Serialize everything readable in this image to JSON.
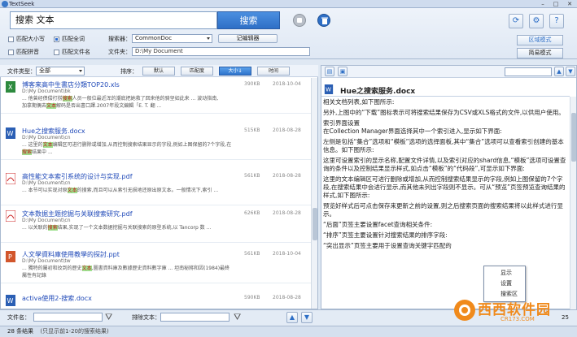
{
  "app": {
    "title": "TextSeek"
  },
  "search": {
    "query": "搜索 文本",
    "button": "搜索"
  },
  "options": {
    "match_case": "匹配大小写",
    "match_whole": "匹配全词",
    "match_pinyin": "匹配拼音",
    "match_filename": "匹配文件名",
    "index_label": "搜索器：",
    "index_value": "CommonDoc",
    "edit_button": "记编辑器",
    "files_label": "文件夹：",
    "files_value": "D:\\My Document"
  },
  "modes": {
    "zone": "区域模式",
    "simple": "简易模式"
  },
  "filter": {
    "type_label": "文件类型：",
    "type_value": "全部",
    "sort_label": "排序：",
    "sort_buttons": [
      "默认",
      "匹配度",
      "大小↓",
      "时间"
    ]
  },
  "results": [
    {
      "name": "博客来高中生書店分類TOP20.xls",
      "path": "D:\\My Document\\bk",
      "size": "390KB",
      "date": "2018-10-04",
      "snip1_a": "... 他曾经债偿打捞",
      "snip1_b": "搜索",
      "snip1_c": "人员一般位最近浑的潮底把她救了回来他的骑坚如此来 ... 波动指南,",
      "snip2_a": "加拿期偶去",
      "snip2_b": "文本",
      "snip2_c": "解码是否出書口譯.2007年段文編輯「E. T. 翻 ..."
    },
    {
      "name": "Hue之搜索服务.docx",
      "path": "D:\\My Document\\cn",
      "size": "515KB",
      "date": "2018-08-28",
      "snip1_a": "... 这里的",
      "snip1_b": "文本",
      "snip1_c": "编辑区可进行删除或增加,从而控制搜索结果显示的字段,例如上图保留的7个字段,在",
      "snip2_a": "搜索",
      "snip2_b": "结果中",
      "snip2_c": " ..."
    },
    {
      "name": "高性能文本索引系统的设计与实现.pdf",
      "path": "D:\\My Document\\cn",
      "size": "561KB",
      "date": "2018-08-28",
      "snip1_a": "... 本节可以实现对原",
      "snip1_b": "文本",
      "snip1_c": "的搜索,而且可以从索引无损地还原出原文本。一般情况下,索引 ...",
      "snip2_a": "",
      "snip2_b": "",
      "snip2_c": ""
    },
    {
      "name": "文本数据主题挖掘与关联搜索研究.pdf",
      "path": "D:\\My Document\\cn",
      "size": "626KB",
      "date": "2018-08-28",
      "snip1_a": "... 以关联的",
      "snip1_b": "搜索",
      "snip1_c": "结果,实现了一个文本数据挖掘与关联搜索的原型系统,以 Tancorp 数 ...",
      "snip2_a": "",
      "snip2_b": "",
      "snip2_c": ""
    },
    {
      "name": "人文學資料庫使用教學的探討.ppt",
      "path": "D:\\My Document\\tw",
      "size": "561KB",
      "date": "2018-10-04",
      "snip1_a": "... 獨特的屬初和玟到的歷史",
      "snip1_b": "文本",
      "snip1_c": ",圖書資料庫及數據歷史資料數字庫 ... 坦南秘將和因(1984)最終",
      "snip2_a": "屬性有記錄",
      "snip2_b": "",
      "snip2_c": " ..."
    },
    {
      "name": "activa使用2-搜索.docx",
      "path": "",
      "size": "590KB",
      "date": "2018-08-28",
      "snip1_a": "",
      "snip1_b": "",
      "snip1_c": "",
      "snip2_a": "",
      "snip2_b": "",
      "snip2_c": ""
    }
  ],
  "preview": {
    "title": "Hue之搜索服务.docx",
    "p1": "相关文档列表,如下图所示:",
    "p2": "另外,上图中的“下载”图标表示可将搜索结果保存为CSV或XLS格式的文件,以供用户使用。",
    "p3": "索引界面设置",
    "p4": "在Collection Manager界面选择其中一个索引进入,显示如下界面:",
    "p5": "左侧是包括“集合”选项和“模板”选项的选择面板,其中“集合”选项可以查看索引创建的基本信息。如下图所示:",
    "p6": "这里可设置索引的显示名称,配置文件详情,以及索引对应的shard信息,“模板”选项可设置查询的条件以及控制结果显示样式,如点击“模板”的“代码段”,可显示如下界面:",
    "p7": "这里的文本编辑区可进行删除或增加,从而控制搜索结果显示的字段,例如上图保留的7个字段,在搜索结果中会进行显示,而其他未列出字段则不显示。可从“预览”页签预览查询结果的样式,如下图所示:",
    "p8": "预览好样式后可点击保存来更新之前的设置,则之后搜索页面的搜索结果将以此样式进行显示。",
    "p9": "“后面”页签主要设置facet查询相关条件:",
    "p10": "“排序”页签主要设置针对搜索结果的排序字段:",
    "p11": "“突出显示”页签主要用于设置查询关键字匹配的"
  },
  "context_menu": [
    "显示",
    "设置",
    "搜索区"
  ],
  "bottom": {
    "filename_label": "文件名：",
    "exclude_label": "排除文本："
  },
  "status": {
    "count": "28 条结果",
    "note": "(只显示前1-20的搜索结果)",
    "page_number": "25"
  },
  "watermark": {
    "text": "西西软件园",
    "domain": "CR173.COM"
  },
  "colors": {
    "accent": "#2e6fc6",
    "highlight": "#9ee08e",
    "link": "#1f49b8"
  }
}
